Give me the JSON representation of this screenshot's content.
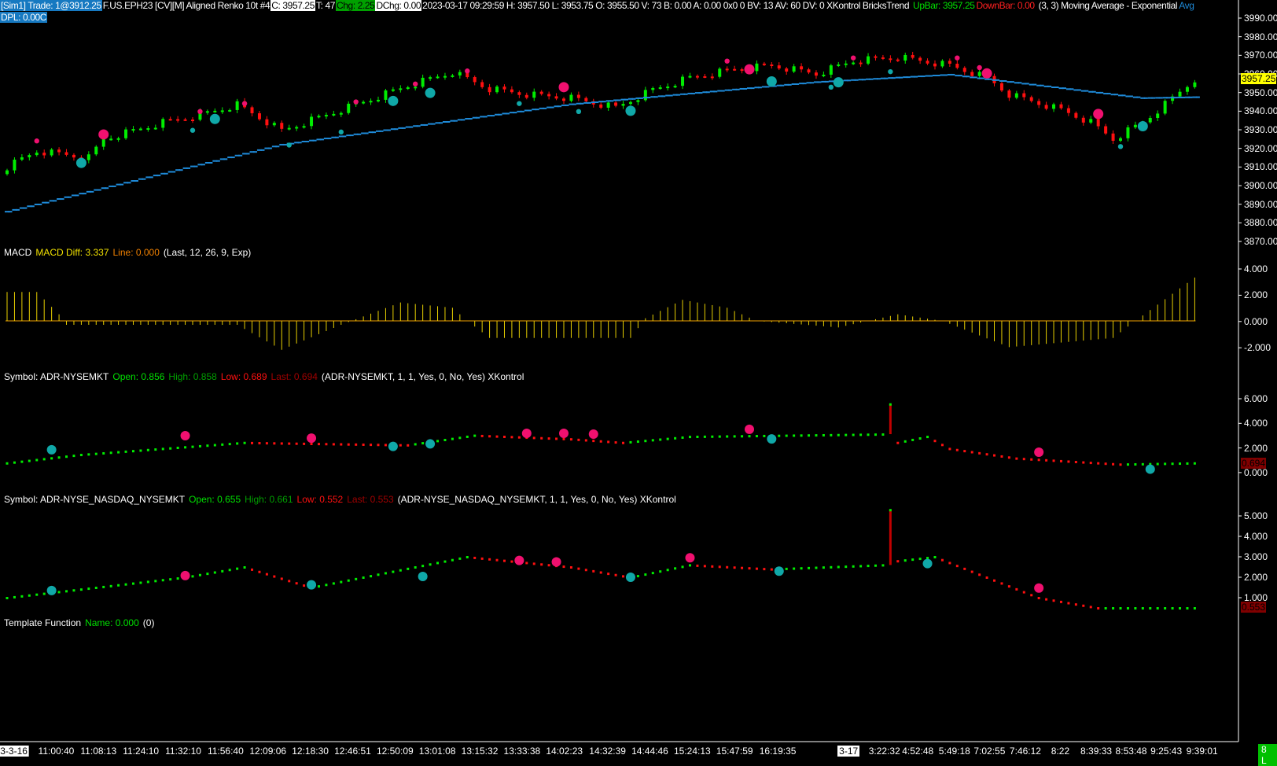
{
  "header": {
    "sim": "[Sim1]  Trade: 1@3912.25",
    "dpl": "DPL: 0.00C",
    "symbol": "F.US.EPH23 [CV][M]  Aligned Renko 10t  #4",
    "close": "C: 3957.25",
    "ticks": "T: 47",
    "chg": "Chg: 2.25",
    "dchg": "DChg: 0.00",
    "stats": "2023-03-17 09:29:59 H: 3957.50 L: 3953.75 O: 3955.50 V: 73 B: 0.00 A: 0.00 0x0 0 BV: 13 AV: 60 DV: 0 XKontrol  BricksTrend",
    "upbar": "UpBar: 3957.25",
    "downbar": "DownBar: 0.00",
    "study_params": "(3, 3)  Moving Average - Exponential",
    "avg": "Avg"
  },
  "colors": {
    "up": "#00ee00",
    "down": "#ff1010",
    "ema": "#1e8ad8",
    "pink": "#f0106f",
    "teal": "#10a8a8",
    "macd": "#e8d000",
    "last_tag": "#ffff00"
  },
  "price_axis": {
    "ticks": [
      "3990.00",
      "3980.00",
      "3970.00",
      "3960.00",
      "3950.00",
      "3940.00",
      "3930.00",
      "3920.00",
      "3910.00",
      "3900.00",
      "3890.00",
      "3880.00",
      "3870.00"
    ],
    "last": "3957.25"
  },
  "macd": {
    "title": "MACD",
    "diff": "MACD Diff: 3.337",
    "line": "Line: 0.000",
    "params": "(Last, 12, 26, 9, Exp)",
    "ticks": [
      "4.000",
      "2.000",
      "0.000",
      "-2.000"
    ]
  },
  "adr1": {
    "title": "Symbol: ADR-NYSEMKT",
    "open": "Open: 0.856",
    "high": "High: 0.858",
    "low": "Low: 0.689",
    "last": "Last: 0.694",
    "params": "(ADR-NYSEMKT, 1, 1, Yes, 0, No, Yes)  XKontrol",
    "ticks": [
      "6.000",
      "4.000",
      "2.000",
      "0.000"
    ],
    "last_tag": "0.694"
  },
  "adr2": {
    "title": "Symbol: ADR-NYSE_NASDAQ_NYSEMKT",
    "open": "Open: 0.655",
    "high": "High: 0.661",
    "low": "Low: 0.552",
    "last": "Last: 0.553",
    "params": "(ADR-NYSE_NASDAQ_NYSEMKT, 1, 1, Yes, 0, No, Yes)  XKontrol",
    "ticks": [
      "5.000",
      "4.000",
      "3.000",
      "2.000",
      "1.000"
    ],
    "last_tag": "0.553"
  },
  "template": {
    "title": "Template Function",
    "name": "Name: 0.000",
    "params": "(0)"
  },
  "time_axis": {
    "labels": [
      "3-3-16",
      "11:00:40",
      "11:08:13",
      "11:24:10",
      "11:32:10",
      "11:56:40",
      "12:09:06",
      "12:18:30",
      "12:46:51",
      "12:50:09",
      "13:01:08",
      "13:15:32",
      "13:33:38",
      "14:02:23",
      "14:32:39",
      "14:44:46",
      "15:24:13",
      "15:47:59",
      "16:19:35",
      "3-17",
      "3:22:32",
      "4:52:48",
      "5:49:18",
      "7:02:55",
      "7:46:12",
      "8:22",
      "8:39:33",
      "8:53:48",
      "9:25:43",
      "9:39:01"
    ],
    "corner": "8 L"
  },
  "chart_data": {
    "type": "line",
    "bar_count": 161,
    "price_close_keypoints": [
      [
        0,
        3910
      ],
      [
        4,
        3918.6
      ],
      [
        11,
        3915
      ],
      [
        13,
        3925
      ],
      [
        21,
        3934
      ],
      [
        26,
        3938
      ],
      [
        31,
        3943.5
      ],
      [
        37,
        3929.6
      ],
      [
        43,
        3938
      ],
      [
        48,
        3945
      ],
      [
        54,
        3953.7
      ],
      [
        60,
        3961
      ],
      [
        65,
        3952
      ],
      [
        70,
        3949
      ],
      [
        76,
        3947
      ],
      [
        82,
        3942
      ],
      [
        87,
        3951.5
      ],
      [
        92,
        3958
      ],
      [
        98,
        3962.5
      ],
      [
        103,
        3964.6
      ],
      [
        109,
        3960
      ],
      [
        114,
        3967
      ],
      [
        120,
        3969
      ],
      [
        127,
        3964.6
      ],
      [
        132,
        3958
      ],
      [
        135,
        3949
      ],
      [
        142,
        3940.7
      ],
      [
        146,
        3934
      ],
      [
        149,
        3925
      ],
      [
        153,
        3934
      ],
      [
        157,
        3947
      ],
      [
        160,
        3957.25
      ]
    ],
    "ema_keypoints": [
      [
        0,
        3886
      ],
      [
        37,
        3922
      ],
      [
        76,
        3943.7
      ],
      [
        109,
        3955.6
      ],
      [
        127,
        3959.6
      ],
      [
        153,
        3947
      ],
      [
        160,
        3947.5
      ]
    ],
    "price_markers": [
      [
        4,
        3924,
        "pink",
        "S"
      ],
      [
        26,
        3939.8,
        "pink",
        "S"
      ],
      [
        32,
        3944.1,
        "pink",
        "S"
      ],
      [
        47,
        3945,
        "pink",
        "S"
      ],
      [
        55,
        3954.6,
        "pink",
        "S"
      ],
      [
        62,
        3961.6,
        "pink",
        "S"
      ],
      [
        97,
        3966.9,
        "pink",
        "S"
      ],
      [
        114,
        3968.6,
        "pink",
        "S"
      ],
      [
        128,
        3968.6,
        "pink",
        "S"
      ],
      [
        131,
        3963.4,
        "pink",
        "S"
      ],
      [
        13,
        3927.5,
        "pink",
        "L"
      ],
      [
        75,
        3952.9,
        "pink",
        "L"
      ],
      [
        100,
        3962.5,
        "pink",
        "L"
      ],
      [
        132,
        3960.3,
        "pink",
        "L"
      ],
      [
        147,
        3938.5,
        "pink",
        "L"
      ],
      [
        25,
        3929.7,
        "teal",
        "S"
      ],
      [
        38,
        3921.8,
        "teal",
        "S"
      ],
      [
        45,
        3928.8,
        "teal",
        "S"
      ],
      [
        69,
        3944.1,
        "teal",
        "S"
      ],
      [
        77,
        3939.8,
        "teal",
        "S"
      ],
      [
        111,
        3952.9,
        "teal",
        "S"
      ],
      [
        119,
        3961.2,
        "teal",
        "S"
      ],
      [
        150,
        3921,
        "teal",
        "S"
      ],
      [
        10,
        3912.2,
        "teal",
        "L"
      ],
      [
        28,
        3935.8,
        "teal",
        "L"
      ],
      [
        52,
        3945.5,
        "teal",
        "L"
      ],
      [
        57,
        3949.8,
        "teal",
        "L"
      ],
      [
        84,
        3940.2,
        "teal",
        "L"
      ],
      [
        103,
        3956,
        "teal",
        "L"
      ],
      [
        112,
        3955.5,
        "teal",
        "L"
      ],
      [
        153,
        3931.9,
        "teal",
        "L"
      ]
    ],
    "macd_keypoints": [
      [
        0,
        2.2
      ],
      [
        4,
        2.2
      ],
      [
        7,
        0.5
      ],
      [
        8,
        -0.3
      ],
      [
        31,
        -0.3
      ],
      [
        37,
        -2.2
      ],
      [
        45,
        -0.3
      ],
      [
        53,
        1.4
      ],
      [
        60,
        1.0
      ],
      [
        62,
        0
      ],
      [
        65,
        -1.3
      ],
      [
        84,
        -1.3
      ],
      [
        86,
        0.2
      ],
      [
        91,
        1.6
      ],
      [
        97,
        1.0
      ],
      [
        101,
        0
      ],
      [
        112,
        -0.5
      ],
      [
        120,
        0.5
      ],
      [
        126,
        0
      ],
      [
        135,
        -2
      ],
      [
        149,
        -1.3
      ],
      [
        152,
        0
      ],
      [
        160,
        3.3
      ]
    ],
    "adr1_keypoints": [
      [
        0,
        0.8
      ],
      [
        10,
        1.5
      ],
      [
        32,
        2.5
      ],
      [
        54,
        2.3
      ],
      [
        63,
        3.1
      ],
      [
        76,
        2.8
      ],
      [
        83,
        2.5
      ],
      [
        92,
        3.0
      ],
      [
        118,
        3.2
      ],
      [
        119,
        5.7
      ],
      [
        120,
        2.5
      ],
      [
        124,
        3
      ],
      [
        127,
        2
      ],
      [
        136,
        1.2
      ],
      [
        150,
        0.7
      ],
      [
        160,
        0.8
      ]
    ],
    "adr1_markers": [
      [
        24,
        3.07,
        "pink"
      ],
      [
        41,
        2.87,
        "pink"
      ],
      [
        70,
        3.27,
        "pink"
      ],
      [
        75,
        3.27,
        "pink"
      ],
      [
        79,
        3.2,
        "pink"
      ],
      [
        100,
        3.6,
        "pink"
      ],
      [
        139,
        1.7,
        "pink"
      ],
      [
        6,
        1.9,
        "teal"
      ],
      [
        52,
        2.18,
        "teal"
      ],
      [
        57,
        2.39,
        "teal"
      ],
      [
        103,
        2.8,
        "teal"
      ],
      [
        154,
        0.29,
        "teal"
      ]
    ],
    "adr2_keypoints": [
      [
        0,
        1.0
      ],
      [
        24,
        2
      ],
      [
        32,
        2.5
      ],
      [
        41,
        1.5
      ],
      [
        48,
        2
      ],
      [
        62,
        3.0
      ],
      [
        76,
        2.5
      ],
      [
        84,
        2
      ],
      [
        92,
        2.6
      ],
      [
        103,
        2.4
      ],
      [
        118,
        2.6
      ],
      [
        119,
        5.3
      ],
      [
        120,
        2.8
      ],
      [
        125,
        3
      ],
      [
        132,
        2
      ],
      [
        139,
        1
      ],
      [
        147,
        0.5
      ],
      [
        160,
        0.5
      ]
    ],
    "adr2_markers": [
      [
        24,
        2.08,
        "pink"
      ],
      [
        69,
        2.82,
        "pink"
      ],
      [
        74,
        2.75,
        "pink"
      ],
      [
        92,
        2.95,
        "pink"
      ],
      [
        139,
        1.47,
        "pink"
      ],
      [
        6,
        1.35,
        "teal"
      ],
      [
        41,
        1.63,
        "teal"
      ],
      [
        56,
        2.04,
        "teal"
      ],
      [
        84,
        2.0,
        "teal"
      ],
      [
        104,
        2.3,
        "teal"
      ],
      [
        124,
        2.67,
        "teal"
      ]
    ]
  }
}
